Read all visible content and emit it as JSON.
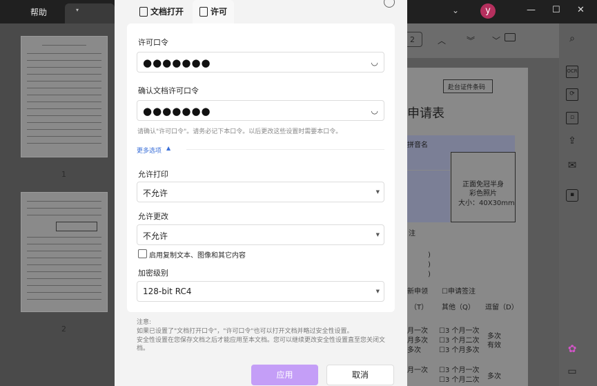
{
  "titlebar": {
    "menu_help": "帮助",
    "tab_chevron": "▾",
    "title_chevron": "⌄",
    "avatar_letter": "y",
    "min": "—",
    "max": "☐",
    "close": "✕"
  },
  "thumbnails": [
    {
      "page_number": "1"
    },
    {
      "page_number": "2"
    }
  ],
  "toolbar": {
    "page_value": "2",
    "icons": [
      "chevron-up-icon",
      "chevron-double-down-icon",
      "chevron-down-icon",
      "presentation-icon"
    ]
  },
  "right_rail": {
    "icons": [
      "search-icon",
      "ocr-icon",
      "convert-icon",
      "file-lock-icon",
      "share-icon",
      "mail-icon",
      "save-icon",
      "apps-icon",
      "comment-icon"
    ],
    "ocr_label": "OCR"
  },
  "document": {
    "stub_label": "赴台证件条码",
    "title_fragment": "申请表",
    "name_pinyin_fragment": "拼音名",
    "photo_line1": "正面免冠半身",
    "photo_line2": "彩色照片",
    "photo_line3": "大小：40X30mm",
    "label_zhu": "注",
    "paren1": ")",
    "paren2": ")",
    "paren3": ")",
    "new_apply": "新申领",
    "apply_sign": "☐申请签注",
    "col_t": "（T）",
    "col_q": "其他（Q）",
    "col_d": "逗留（D）",
    "row_a1": "月一次",
    "row_a2": "月多次",
    "row_a3": "多次",
    "row_b1": "☐3 个月一次",
    "row_b2": "☐3 个月二次",
    "row_b3": "☐3 个月多次",
    "row_c1": "多次",
    "row_c2": "有效",
    "bottom_a": "月一次",
    "bottom_b1": "☐3 个月一次",
    "bottom_b2": "☐3 个月二次",
    "bottom_c": "多次"
  },
  "dialog": {
    "tabs": [
      {
        "label": "文档打开",
        "icon": "lock-document-icon"
      },
      {
        "label": "许可",
        "icon": "edit-document-icon"
      }
    ],
    "permission_password": {
      "label": "许可口令",
      "value": "●●●●●●●"
    },
    "confirm_password": {
      "label": "确认文档许可口令",
      "value": "●●●●●●●"
    },
    "eye_glyph": "◡",
    "hint": "请确认\"许可口令\"。请务必记下本口令。以后更改这些设置时需要本口令。",
    "more_options": "更多选项",
    "more_caret": "▲",
    "allow_print": {
      "label": "允许打印",
      "value": "不允许"
    },
    "allow_change": {
      "label": "允许更改",
      "value": "不允许"
    },
    "copy_checkbox": {
      "label": "启用复制文本、图像和其它内容",
      "checked": false
    },
    "encryption": {
      "label": "加密级别",
      "value": "128-bit RC4"
    },
    "select_arrow": "▼",
    "note_title": "注意:",
    "notes": [
      "如果已设置了\"文档打开口令\"，\"许可口令\"也可以打开文档并略过安全性设置。",
      "安全性设置在您保存文档之后才能应用至本文档。您可以继续更改安全性设置直至您关闭文",
      "档。"
    ],
    "apply": "应用",
    "cancel": "取消"
  },
  "colors": {
    "accent": "#c49ef7",
    "link": "#3a6fd8",
    "avatar": "#b5305e"
  }
}
